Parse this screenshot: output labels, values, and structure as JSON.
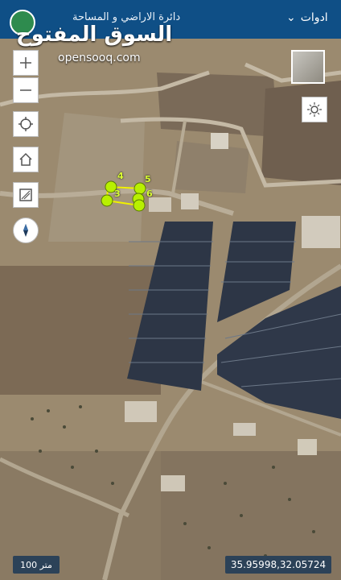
{
  "topbar": {
    "tools_label": "ادوات",
    "department": "دائرة الاراضي و المساحة"
  },
  "brand": {
    "arabic": "السوق المفتوح",
    "english": "opensooq.com"
  },
  "map": {
    "zoom_in": "+",
    "zoom_out": "−",
    "scale_label": "100 متر",
    "coordinates": "35.95998,32.05724",
    "plot_numbers": [
      "4",
      "5",
      "3",
      "6"
    ]
  },
  "colors": {
    "topbar": "#0f4f86",
    "plot_marker": "#b8f000"
  },
  "icons": {
    "zoom_in": "plus-icon",
    "zoom_out": "minus-icon",
    "locate": "locate-icon",
    "home": "home-icon",
    "measure": "measure-icon",
    "compass": "compass-icon",
    "brightness": "sun-icon",
    "dropdown": "chevron-down-icon"
  }
}
